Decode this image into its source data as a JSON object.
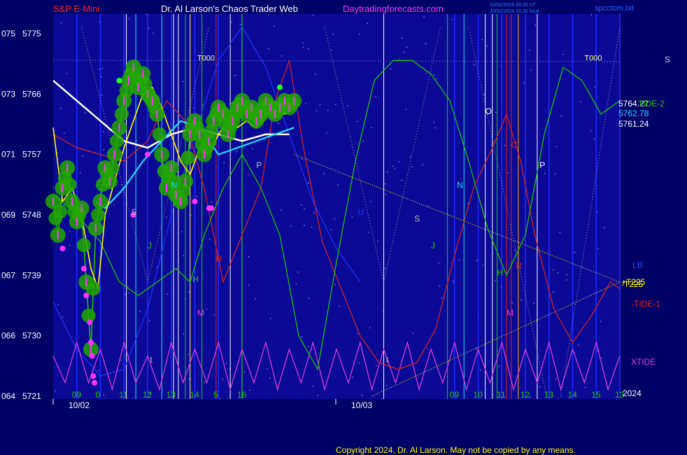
{
  "header": {
    "symbol": "S&P E-Mini",
    "site_title": "Dr. Al Larson's Chaos Trader Web",
    "site_url": "Daytradingforecasts.com",
    "timestamp_line1": "10/02/2024 20:20 UT",
    "timestamp_line2": "10/02/2024 16:20 local",
    "file_name": "spcctom.txt"
  },
  "copyright": "Copyright 2024, Dr. Al Larson. May not be copied by any means.",
  "colors": {
    "background": "#000066",
    "plot_area": "#0a0a96",
    "axis_blue": "#1e2cff",
    "price_green": "#22c800",
    "moving_avg_white": "#ffffff",
    "moving_avg_cyan": "#22ddff",
    "moving_avg_yellow": "#ffff00",
    "tide_green": "#22c800",
    "tide_red": "#dd2222",
    "tide_blue": "#2233ff",
    "xtide_magenta": "#e040e0",
    "marker_magenta": "#ff33ff",
    "title_red": "#ff2222",
    "title_magenta": "#ff33ff"
  },
  "chart_data": {
    "type": "line",
    "title": "S&P E-Mini",
    "y_axis_left_outer": [
      "075",
      "073",
      "071",
      "069",
      "067",
      "066",
      "064"
    ],
    "y_axis_left_inner": [
      "5775",
      "5766",
      "5757",
      "5748",
      "5739",
      "5730",
      "5721"
    ],
    "ylim": [
      5721,
      5775
    ],
    "x_ticks": [
      "09",
      "0",
      "11",
      "12",
      "13",
      "14",
      "5",
      "16",
      "09",
      "10",
      "11",
      "12",
      "13",
      "14",
      "15",
      "13"
    ],
    "x_dates": [
      "10/02",
      "10/03"
    ],
    "x_hours": [
      9,
      10,
      11,
      12,
      13,
      14,
      15,
      16,
      25,
      26,
      27,
      28,
      29,
      30,
      31,
      32
    ],
    "xlim": [
      8,
      32
    ],
    "right_price_labels": [
      {
        "text": "5764.27",
        "value": 5764.27,
        "color": "#ffffff"
      },
      {
        "text": "5762.78",
        "value": 5762.78,
        "color": "#22ddff"
      },
      {
        "text": "5761.24",
        "value": 5761.24,
        "color": "#ffffff"
      }
    ],
    "right_series_labels": [
      {
        "text": "S",
        "color": "#cccccc"
      },
      {
        "text": "TIDE-2",
        "color": "#22c800"
      },
      {
        "text": "LB",
        "color": "#2244ff"
      },
      {
        "text": "+T225",
        "color": "#ffff00"
      },
      {
        "text": "-T225",
        "color": "#ffff00"
      },
      {
        "text": "-TIDE-1",
        "color": "#dd2222"
      },
      {
        "text": "XTIDE",
        "color": "#e040e0"
      },
      {
        "text": "2024",
        "color": "#ffffff"
      }
    ],
    "vertical_line_labels": [
      {
        "text": "T000",
        "x": 14.1,
        "y": 5771,
        "color": "#ffff88"
      },
      {
        "text": "T000",
        "x": 30.5,
        "y": 5771,
        "color": "#ffff88"
      }
    ],
    "letter_annotations": [
      {
        "text": "S",
        "x": 11.3,
        "y": 5748,
        "color": "#bbbbbb"
      },
      {
        "text": "J",
        "x": 12.0,
        "y": 5743,
        "color": "#22c800"
      },
      {
        "text": "N",
        "x": 13.0,
        "y": 5752,
        "color": "#22ddff"
      },
      {
        "text": "R",
        "x": 14.9,
        "y": 5741,
        "color": "#dd2222"
      },
      {
        "text": "H",
        "x": 13.9,
        "y": 5738,
        "color": "#22c800"
      },
      {
        "text": "M",
        "x": 14.1,
        "y": 5733,
        "color": "#dd44dd"
      },
      {
        "text": "P",
        "x": 16.6,
        "y": 5755,
        "color": "#bbbbbb"
      },
      {
        "text": "U",
        "x": 20.9,
        "y": 5748,
        "color": "#2244ff"
      },
      {
        "text": "S",
        "x": 23.3,
        "y": 5747,
        "color": "#bbbbbb"
      },
      {
        "text": "J",
        "x": 24.0,
        "y": 5743,
        "color": "#22c800"
      },
      {
        "text": "N",
        "x": 25.1,
        "y": 5752,
        "color": "#22ddff"
      },
      {
        "text": "O",
        "x": 26.3,
        "y": 5763,
        "color": "#ffffff"
      },
      {
        "text": "C",
        "x": 27.4,
        "y": 5758,
        "color": "#dd2222"
      },
      {
        "text": "P",
        "x": 28.6,
        "y": 5755,
        "color": "#ffffff"
      },
      {
        "text": "H",
        "x": 26.8,
        "y": 5739,
        "color": "#22c800"
      },
      {
        "text": "R",
        "x": 27.6,
        "y": 5740,
        "color": "#dd2222"
      },
      {
        "text": "M",
        "x": 27.2,
        "y": 5733,
        "color": "#dd44dd"
      },
      {
        "text": "t",
        "x": 12.1,
        "y": 5726,
        "color": "#bbbbbb"
      },
      {
        "text": "t",
        "x": 22.1,
        "y": 5726,
        "color": "#bbbbbb"
      }
    ],
    "vertical_lines": [
      {
        "x": 11.1,
        "color": "#ffffff"
      },
      {
        "x": 11.5,
        "color": "#22ddff"
      },
      {
        "x": 12.6,
        "color": "#22ddff"
      },
      {
        "x": 13.1,
        "color": "#ffffff"
      },
      {
        "x": 13.3,
        "color": "#ffffff"
      },
      {
        "x": 13.6,
        "color": "#22c800"
      },
      {
        "x": 13.8,
        "color": "#ffff66"
      },
      {
        "x": 14.3,
        "color": "#22c800"
      },
      {
        "x": 14.9,
        "color": "#dd2222"
      },
      {
        "x": 15.5,
        "color": "#ffffff"
      },
      {
        "x": 16.0,
        "color": "#22c800"
      },
      {
        "x": 22.0,
        "color": "#ffffff"
      },
      {
        "x": 24.7,
        "color": "#22c800"
      },
      {
        "x": 25.4,
        "color": "#22ddff"
      },
      {
        "x": 26.3,
        "color": "#ffffff"
      },
      {
        "x": 26.6,
        "color": "#ffffff"
      },
      {
        "x": 26.8,
        "color": "#22c800"
      },
      {
        "x": 27.2,
        "color": "#dd2222"
      },
      {
        "x": 27.4,
        "color": "#dd2222"
      },
      {
        "x": 27.7,
        "color": "#ffaa00"
      },
      {
        "x": 28.5,
        "color": "#ffffff"
      }
    ],
    "series": [
      {
        "key": "price",
        "color": "#22c800",
        "x": [
          8.0,
          8.2,
          8.4,
          8.6,
          8.8,
          9.0,
          9.2,
          9.4,
          9.6,
          9.8,
          10.0,
          10.2,
          10.4,
          10.6,
          10.8,
          11.0,
          11.2,
          11.4,
          11.6,
          11.8,
          12.0,
          12.2,
          12.4,
          12.6,
          12.8,
          13.0,
          13.2,
          13.4,
          13.6,
          13.8,
          14.0,
          14.2,
          14.4,
          14.6,
          14.8,
          15.0,
          15.2,
          15.4,
          15.6,
          15.8,
          16.0,
          16.2,
          16.4,
          16.6,
          16.8,
          17.0,
          17.2,
          17.4,
          17.6,
          17.8,
          18.0,
          18.2
        ],
        "y": [
          5750,
          5745,
          5752,
          5755,
          5750,
          5747,
          5749,
          5738,
          5728,
          5746,
          5750,
          5755,
          5753,
          5757,
          5761,
          5765,
          5768,
          5770,
          5767,
          5769,
          5766,
          5765,
          5763,
          5757,
          5752,
          5755,
          5751,
          5750,
          5753,
          5760,
          5762,
          5760,
          5757,
          5759,
          5762,
          5764,
          5763,
          5760,
          5762,
          5764,
          5765,
          5763,
          5764,
          5762,
          5763,
          5765,
          5764,
          5763,
          5764,
          5765,
          5764,
          5765
        ]
      },
      {
        "key": "ma_white",
        "color": "#ffffff",
        "x": [
          8.0,
          9.0,
          10.0,
          11.0,
          12.0,
          13.0,
          14.0,
          15.0,
          16.0,
          17.0,
          18.0
        ],
        "y": [
          5768,
          5765,
          5762,
          5759,
          5758,
          5760,
          5761,
          5760,
          5759,
          5760,
          5760
        ]
      },
      {
        "key": "ma_cyan",
        "color": "#22ddff",
        "x": [
          9.8,
          10.2,
          11.0,
          11.8,
          12.6,
          13.4,
          14.2,
          15.0,
          15.8,
          16.6,
          17.4,
          18.2
        ],
        "y": [
          5750,
          5749,
          5752,
          5756,
          5759,
          5762,
          5761,
          5757,
          5758,
          5759,
          5760,
          5761
        ]
      },
      {
        "key": "ma_yellow",
        "color": "#ffff00",
        "x": [
          8.0,
          8.4,
          8.8,
          9.2,
          9.6,
          9.9,
          10.2,
          10.6,
          11.0,
          11.4,
          11.8,
          12.2,
          12.6,
          13.0,
          13.4,
          13.8,
          14.2,
          14.6,
          15.0,
          15.4,
          15.8,
          16.2,
          16.6,
          17.0,
          17.4,
          17.8,
          18.2
        ],
        "y": [
          5761,
          5750,
          5752,
          5748,
          5740,
          5737,
          5748,
          5753,
          5758,
          5762,
          5766,
          5767,
          5764,
          5760,
          5756,
          5754,
          5758,
          5757,
          5760,
          5762,
          5761,
          5762,
          5761,
          5763,
          5764,
          5763,
          5764
        ]
      },
      {
        "key": "tide_green",
        "color": "#22c800",
        "x": [
          8.0,
          9.0,
          10.0,
          10.8,
          11.6,
          12.4,
          13.2,
          13.8,
          14.4,
          15.2,
          16.0,
          16.8,
          17.6,
          18.4,
          19.2,
          20.0,
          20.8,
          21.6,
          22.4,
          23.2,
          24.0,
          24.8,
          25.6,
          26.4,
          27.2,
          28.0,
          28.8,
          29.6,
          30.4,
          31.2,
          32.0
        ],
        "y": [
          5751,
          5748,
          5744,
          5738,
          5736,
          5738,
          5740,
          5738,
          5745,
          5752,
          5757,
          5752,
          5745,
          5730,
          5725,
          5741,
          5756,
          5768,
          5771,
          5771,
          5769,
          5765,
          5756,
          5746,
          5739,
          5745,
          5760,
          5770,
          5768,
          5763,
          5765
        ]
      },
      {
        "key": "tide_red",
        "color": "#dd2222",
        "x": [
          8.0,
          9.0,
          10.0,
          11.0,
          12.0,
          12.8,
          13.6,
          14.4,
          15.2,
          16.0,
          16.8,
          17.4,
          18.0,
          18.6,
          19.4,
          20.2,
          21.0,
          21.8,
          22.6,
          23.4,
          24.2,
          25.0,
          25.8,
          26.6,
          27.2,
          27.8,
          28.4,
          29.2,
          30.0,
          30.8,
          31.6,
          32.0
        ],
        "y": [
          5760,
          5758,
          5757,
          5756,
          5759,
          5765,
          5762,
          5752,
          5738,
          5745,
          5752,
          5765,
          5771,
          5758,
          5744,
          5737,
          5730,
          5726,
          5725,
          5726,
          5731,
          5742,
          5752,
          5758,
          5763,
          5756,
          5745,
          5734,
          5729,
          5733,
          5738,
          5737
        ]
      },
      {
        "key": "tide_blue",
        "color": "#2233ff",
        "x": [
          8.0,
          9.0,
          10.0,
          11.0,
          12.0,
          13.0,
          14.0,
          15.0,
          16.0,
          17.0,
          18.0,
          19.0,
          20.0,
          21.0
        ],
        "y": [
          5735,
          5728,
          5724,
          5725,
          5734,
          5748,
          5760,
          5771,
          5776,
          5770,
          5760,
          5750,
          5743,
          5738
        ]
      },
      {
        "key": "xtide",
        "color": "#e040e0",
        "x": [
          8.0,
          8.5,
          9.0,
          9.5,
          10.0,
          10.5,
          11.0,
          11.5,
          12.0,
          12.5,
          13.0,
          13.5,
          14.0,
          14.5,
          15.0,
          15.5,
          16.0,
          16.5,
          17.0,
          17.5,
          18.0,
          18.5,
          19.0,
          19.5,
          20.0,
          20.5,
          21.0,
          21.5,
          22.0,
          22.5,
          23.0,
          23.5,
          24.0,
          24.5,
          25.0,
          25.5,
          26.0,
          26.5,
          27.0,
          27.5,
          28.0,
          28.5,
          29.0,
          29.5,
          30.0,
          30.5,
          31.0,
          31.5,
          32.0
        ],
        "y": [
          5727,
          5723,
          5729,
          5723,
          5728,
          5722,
          5729,
          5723,
          5727,
          5722,
          5729,
          5723,
          5728,
          5723,
          5729,
          5722,
          5728,
          5723,
          5729,
          5722,
          5728,
          5723,
          5729,
          5722,
          5728,
          5723,
          5729,
          5722,
          5728,
          5723,
          5729,
          5722,
          5728,
          5723,
          5729,
          5722,
          5728,
          5723,
          5729,
          5722,
          5728,
          5723,
          5729,
          5722,
          5728,
          5723,
          5729,
          5722,
          5727
        ]
      },
      {
        "key": "trend_upper",
        "color": "#ffff00",
        "x": [
          18.2,
          32.0
        ],
        "y": [
          5757,
          5738
        ]
      },
      {
        "key": "trend_lower",
        "color": "#ffff00",
        "x": [
          21.5,
          32.0
        ],
        "y": [
          5721,
          5738
        ]
      }
    ],
    "grid": false,
    "legend": "right"
  }
}
